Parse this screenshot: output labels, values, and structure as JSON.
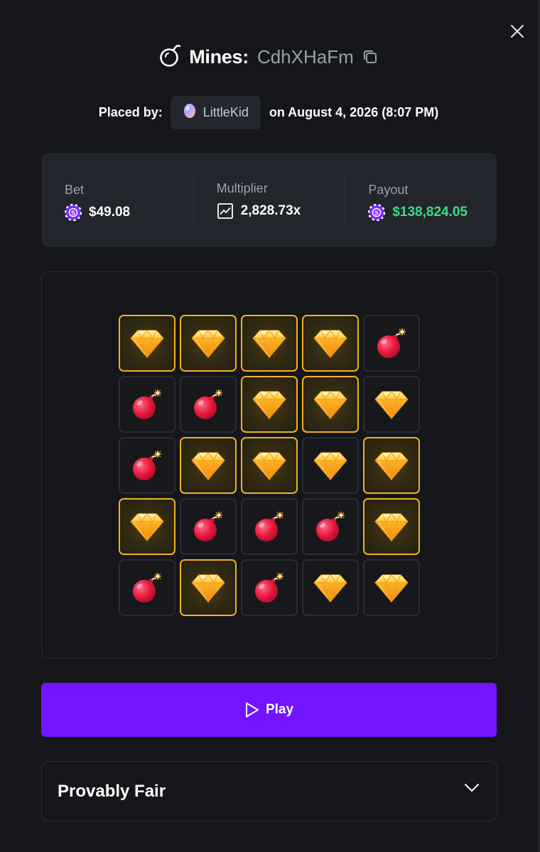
{
  "modal": {
    "game_name": "Mines:",
    "game_id": "CdhXHaFm",
    "placed_by_label": "Placed by:",
    "username": "LittleKid",
    "placed_on": "on August 4, 2026 (8:07 PM)"
  },
  "stats": {
    "bet": {
      "label": "Bet",
      "value": "$49.08",
      "icon": "chip-icon"
    },
    "multiplier": {
      "label": "Multiplier",
      "value": "2,828.73x",
      "icon": "chart-icon"
    },
    "payout": {
      "label": "Payout",
      "value": "$138,824.05",
      "icon": "chip-icon",
      "color": "#3ddc84"
    }
  },
  "board": {
    "rows": 5,
    "cols": 5,
    "tiles": [
      {
        "type": "gem",
        "revealed": true
      },
      {
        "type": "gem",
        "revealed": true
      },
      {
        "type": "gem",
        "revealed": true
      },
      {
        "type": "gem",
        "revealed": true
      },
      {
        "type": "mine",
        "revealed": false
      },
      {
        "type": "mine",
        "revealed": false
      },
      {
        "type": "mine",
        "revealed": false
      },
      {
        "type": "gem",
        "revealed": true
      },
      {
        "type": "gem",
        "revealed": true
      },
      {
        "type": "gem",
        "revealed": false
      },
      {
        "type": "mine",
        "revealed": false
      },
      {
        "type": "gem",
        "revealed": true
      },
      {
        "type": "gem",
        "revealed": true
      },
      {
        "type": "gem",
        "revealed": false
      },
      {
        "type": "gem",
        "revealed": true
      },
      {
        "type": "gem",
        "revealed": true
      },
      {
        "type": "mine",
        "revealed": false
      },
      {
        "type": "mine",
        "revealed": false
      },
      {
        "type": "mine",
        "revealed": false
      },
      {
        "type": "gem",
        "revealed": true
      },
      {
        "type": "mine",
        "revealed": false
      },
      {
        "type": "gem",
        "revealed": true
      },
      {
        "type": "mine",
        "revealed": false
      },
      {
        "type": "gem",
        "revealed": false
      },
      {
        "type": "gem",
        "revealed": false
      }
    ]
  },
  "play_button": {
    "label": "Play"
  },
  "provably_fair": {
    "title": "Provably Fair"
  },
  "colors": {
    "accent": "#7214ff",
    "gem_border": "#f0b21e",
    "payout_green": "#3ddc84",
    "chip_purple": "#7b2cff"
  }
}
